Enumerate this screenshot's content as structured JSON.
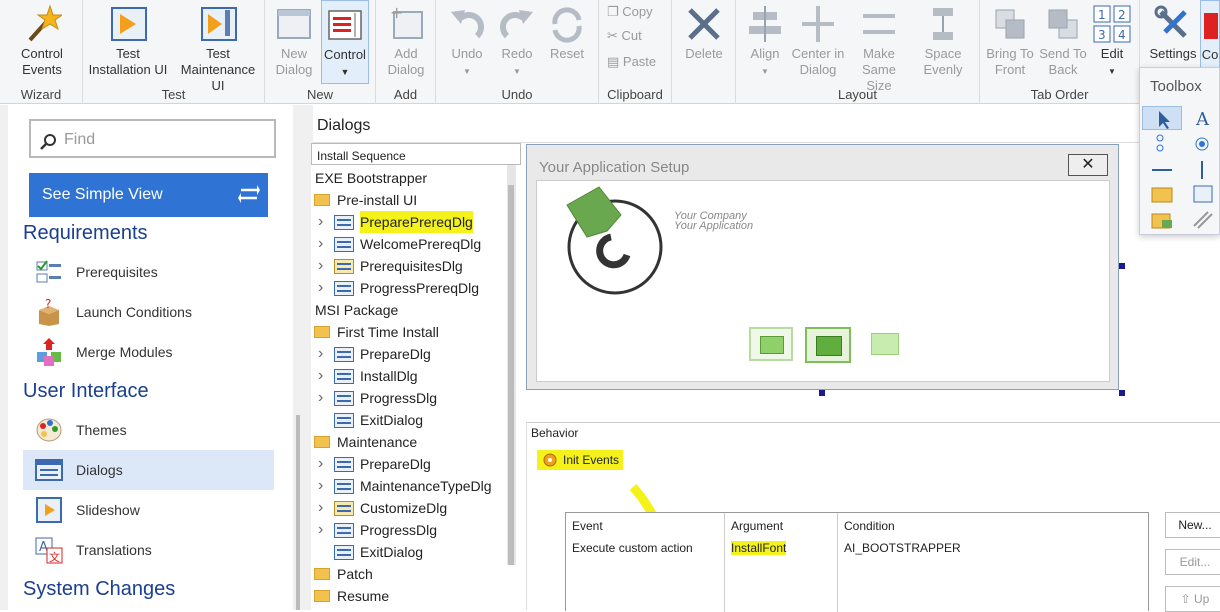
{
  "ribbon": {
    "groups": {
      "wizard": "Wizard",
      "test": "Test",
      "new": "New",
      "add": "Add",
      "undo": "Undo",
      "clipboard": "Clipboard",
      "layout": "Layout",
      "tab_order": "Tab Order"
    },
    "buttons": {
      "control_events": "Control\nEvents",
      "test_installation_ui": "Test\nInstallation UI",
      "test_maintenance_ui": "Test\nMaintenance UI",
      "new_dialog": "New\nDialog",
      "control": "Control",
      "add_dialog": "Add\nDialog",
      "undo": "Undo",
      "redo": "Redo",
      "reset": "Reset",
      "copy": "Copy",
      "cut": "Cut",
      "paste": "Paste",
      "delete": "Delete",
      "align": "Align",
      "center_in_dialog": "Center in\nDialog",
      "make_same_size": "Make Same\nSize",
      "space_evenly": "Space\nEvenly",
      "bring_to_front": "Bring To\nFront",
      "send_to_back": "Send To\nBack",
      "edit": "Edit",
      "settings": "Settings",
      "co": "Co"
    }
  },
  "sidebar": {
    "find_placeholder": "Find",
    "simple_view": "See Simple View",
    "categories": {
      "requirements": "Requirements",
      "user_interface": "User Interface",
      "system_changes": "System Changes"
    },
    "items": {
      "prerequisites": "Prerequisites",
      "launch_conditions": "Launch Conditions",
      "merge_modules": "Merge Modules",
      "themes": "Themes",
      "dialogs": "Dialogs",
      "slideshow": "Slideshow",
      "translations": "Translations"
    }
  },
  "main": {
    "title": "Dialogs",
    "tree_header": "Install Sequence",
    "tree": [
      {
        "text": "EXE Bootstrapper"
      },
      {
        "text": "Pre-install UI"
      },
      {
        "text": "PreparePrereqDlg"
      },
      {
        "text": "WelcomePrereqDlg"
      },
      {
        "text": "PrerequisitesDlg"
      },
      {
        "text": "ProgressPrereqDlg"
      },
      {
        "text": "MSI Package"
      },
      {
        "text": "First Time Install"
      },
      {
        "text": "PrepareDlg"
      },
      {
        "text": "InstallDlg"
      },
      {
        "text": "ProgressDlg"
      },
      {
        "text": "ExitDialog"
      },
      {
        "text": "Maintenance"
      },
      {
        "text": "PrepareDlg"
      },
      {
        "text": "MaintenanceTypeDlg"
      },
      {
        "text": "CustomizeDlg"
      },
      {
        "text": "ProgressDlg"
      },
      {
        "text": "ExitDialog"
      },
      {
        "text": "Patch"
      },
      {
        "text": "Resume"
      }
    ],
    "preview": {
      "title": "Your Application Setup",
      "company": "Your Company",
      "application": "Your Application"
    }
  },
  "behavior": {
    "header": "Behavior",
    "init_events": "Init Events",
    "columns": {
      "event": "Event",
      "argument": "Argument",
      "condition": "Condition"
    },
    "row": {
      "event": "Execute custom action",
      "argument": "InstallFont",
      "condition": "AI_BOOTSTRAPPER"
    },
    "buttons": {
      "new": "New...",
      "edit": "Edit...",
      "up": "Up"
    }
  },
  "toolbox": {
    "title": "Toolbox"
  },
  "colors": {
    "accent": "#2f73d4",
    "highlight": "#f4f21a",
    "category": "#1a3f8f"
  }
}
